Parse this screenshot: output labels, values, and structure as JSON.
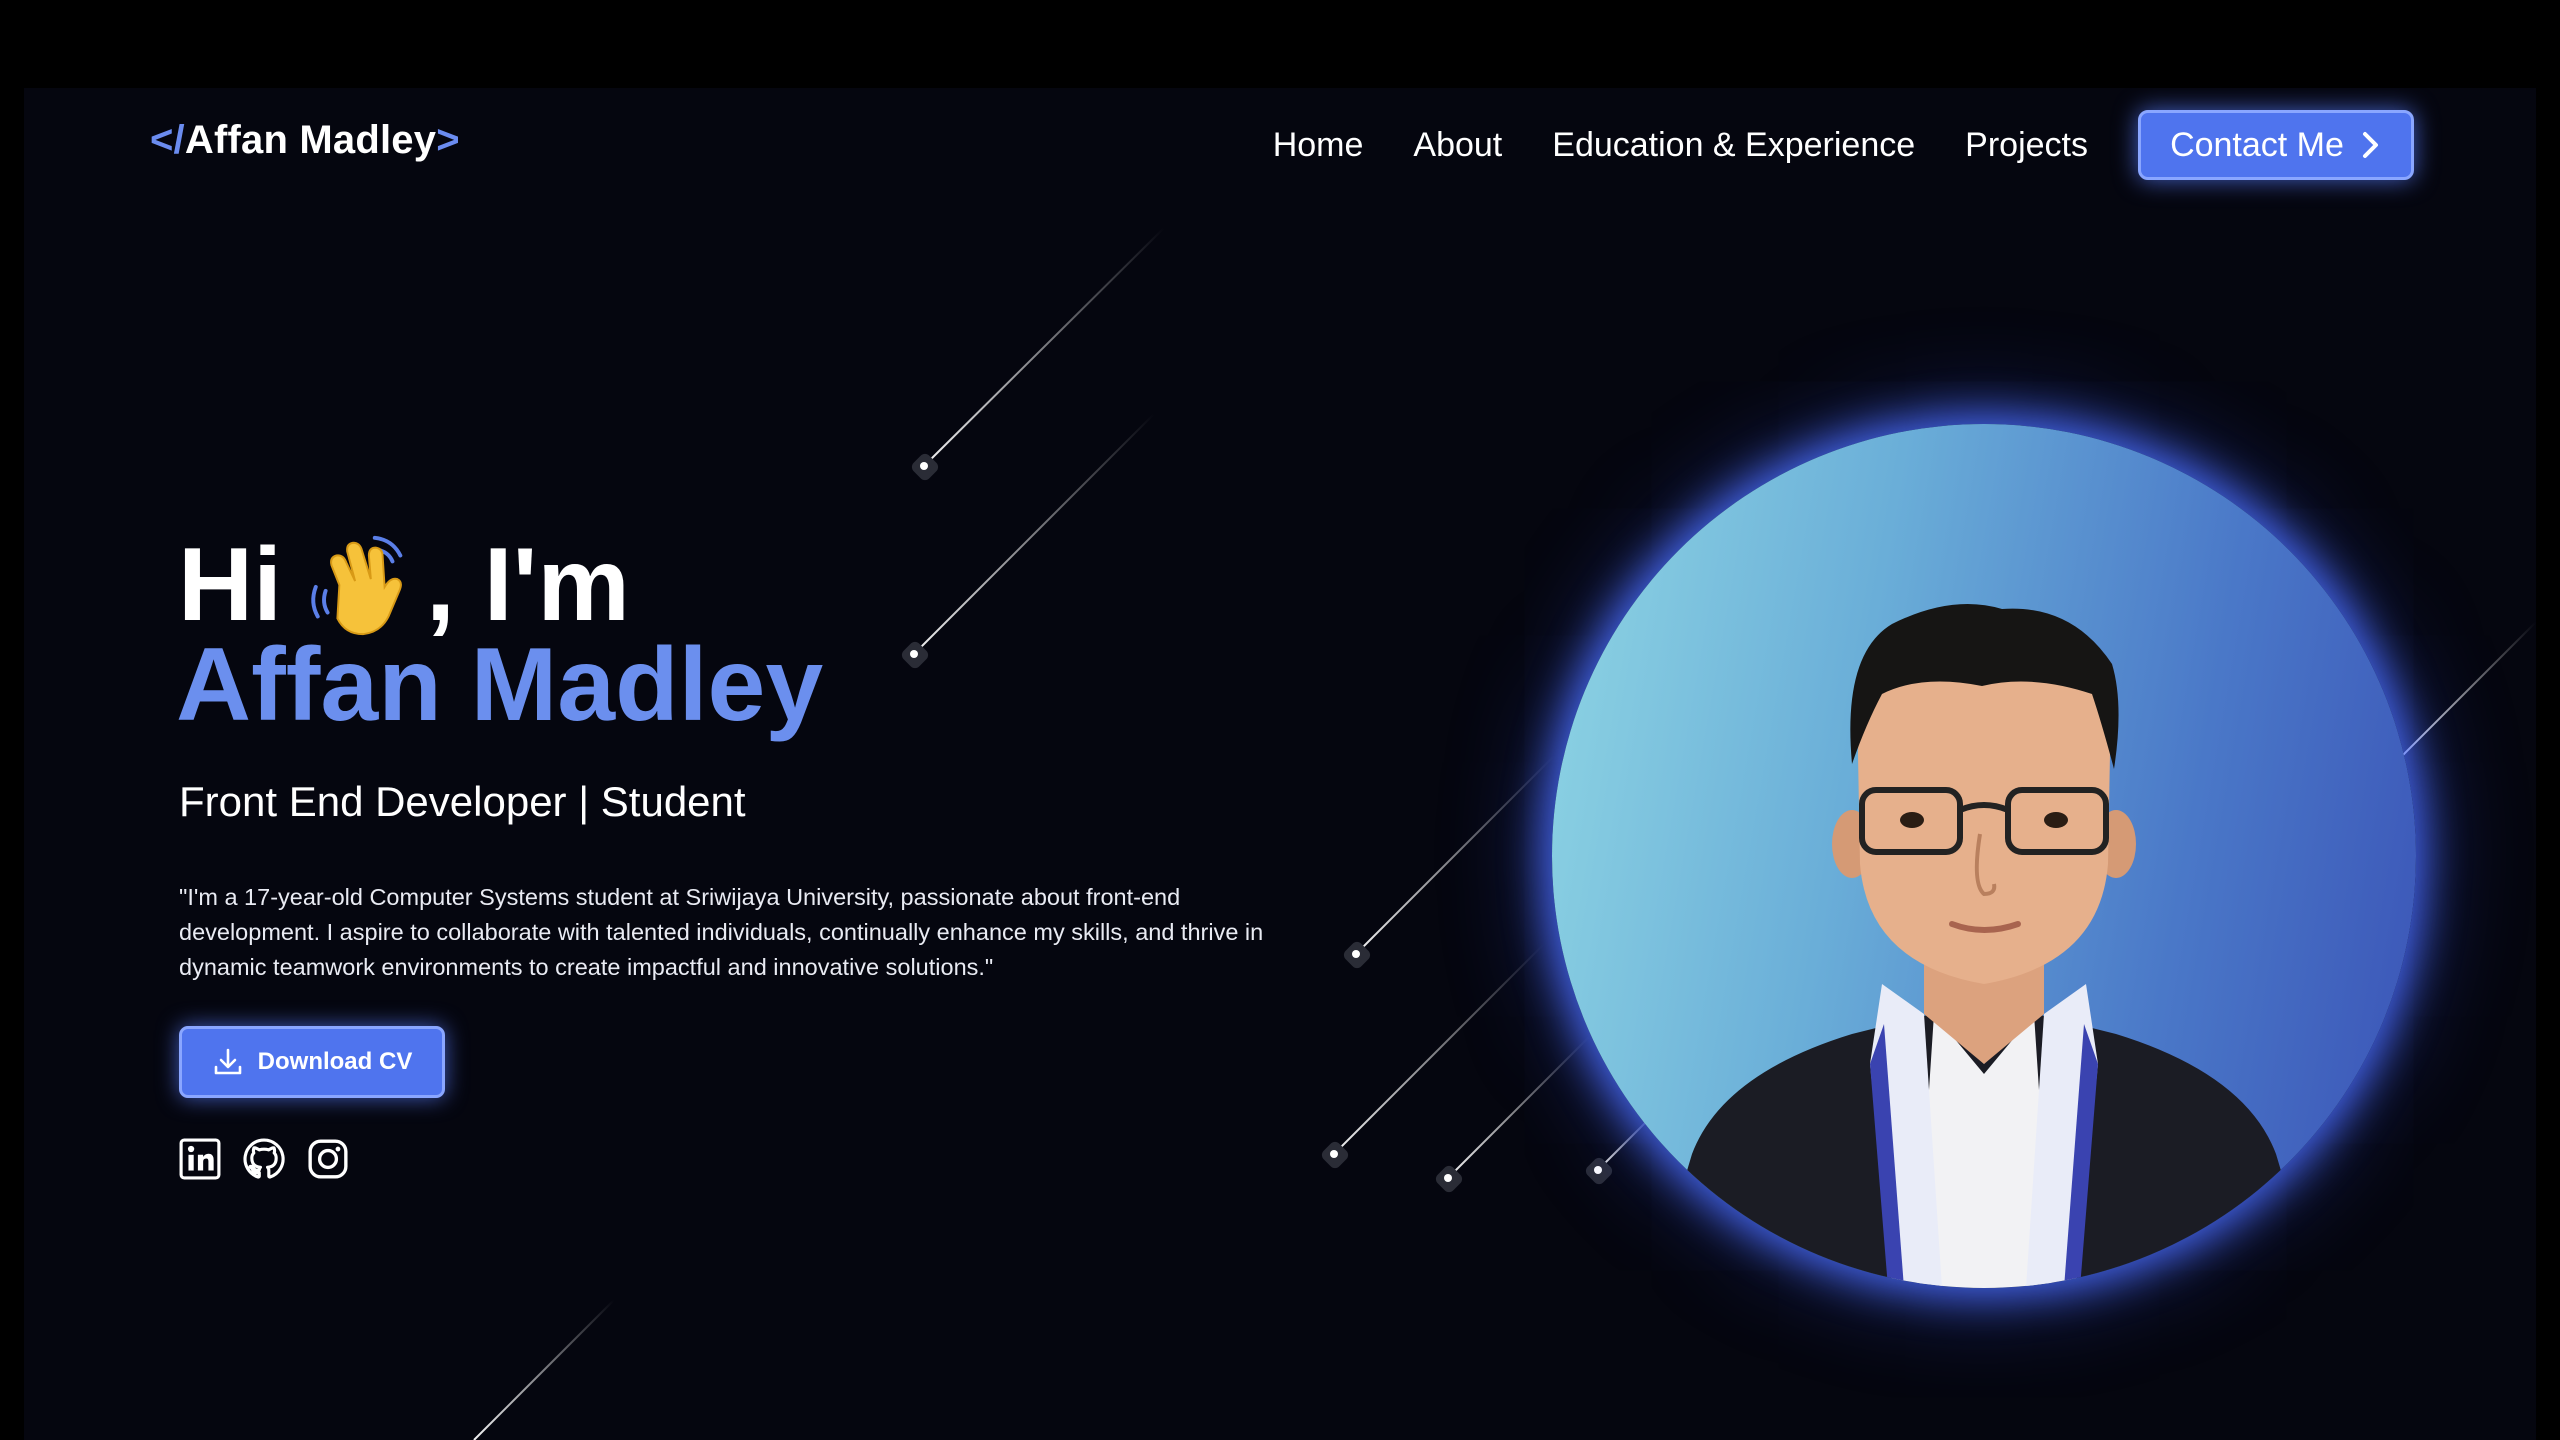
{
  "logo": {
    "open": "</",
    "name": "Affan Madley",
    "close": ">"
  },
  "nav": {
    "items": [
      "Home",
      "About",
      "Education & Experience",
      "Projects"
    ],
    "contact_label": "Contact Me"
  },
  "hero": {
    "greeting_hi": "Hi",
    "greeting_im": ", I'm",
    "name": "Affan Madley",
    "role": "Front End Developer | Student",
    "bio": "\"I'm a 17-year-old Computer Systems student at Sriwijaya University, passionate about front-end development. I aspire to collaborate with talented individuals, continually enhance my skills, and thrive in dynamic teamwork environments to create impactful and innovative solutions.\"",
    "cv_label": "Download CV"
  },
  "socials": [
    "linkedin-icon",
    "github-icon",
    "instagram-icon"
  ],
  "colors": {
    "background": "#05060f",
    "accent": "#4f74ee",
    "accent_text": "#6b8fee",
    "glow": "#5a7dff"
  }
}
